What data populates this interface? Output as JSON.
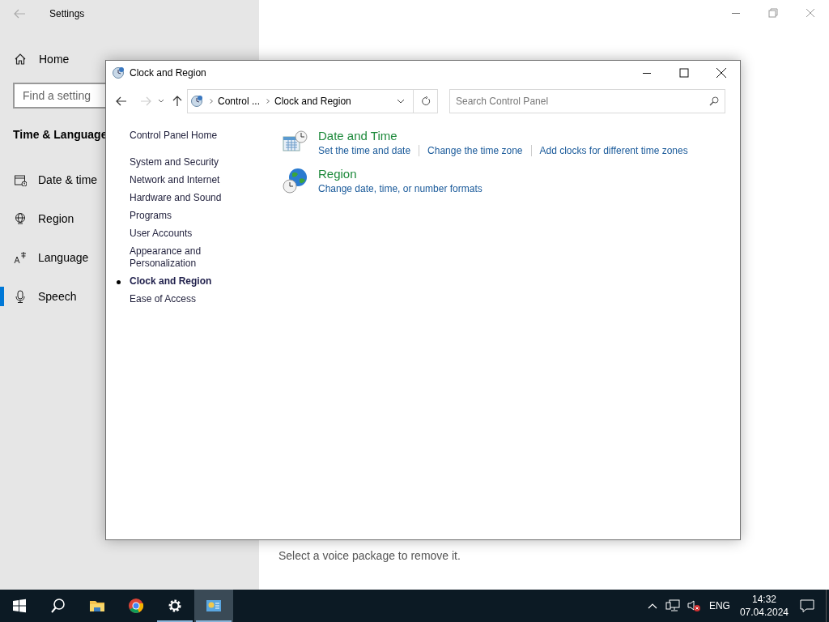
{
  "settings": {
    "title": "Settings",
    "home": "Home",
    "search_placeholder": "Find a setting",
    "section": "Time & Language",
    "nav": [
      {
        "kind": "calendar",
        "label": "Date & time",
        "selected": false
      },
      {
        "kind": "globe",
        "label": "Region",
        "selected": false
      },
      {
        "kind": "language",
        "label": "Language",
        "selected": false
      },
      {
        "kind": "microphone",
        "label": "Speech",
        "selected": true
      }
    ],
    "hint": "Select a voice package to remove it."
  },
  "control_panel": {
    "title": "Clock and Region",
    "breadcrumb": [
      "Control ...",
      "Clock and Region"
    ],
    "search_placeholder": "Search Control Panel",
    "home_link": "Control Panel Home",
    "nav": [
      {
        "label": "System and Security",
        "selected": false
      },
      {
        "label": "Network and Internet",
        "selected": false
      },
      {
        "label": "Hardware and Sound",
        "selected": false
      },
      {
        "label": "Programs",
        "selected": false
      },
      {
        "label": "User Accounts",
        "selected": false
      },
      {
        "label": "Appearance and Personalization",
        "selected": false
      },
      {
        "label": "Clock and Region",
        "selected": true
      },
      {
        "label": "Ease of Access",
        "selected": false
      }
    ],
    "categories": [
      {
        "kind": "datetime",
        "title": "Date and Time",
        "links": [
          "Set the time and date",
          "Change the time zone",
          "Add clocks for different time zones"
        ]
      },
      {
        "kind": "region",
        "title": "Region",
        "links": [
          "Change date, time, or number formats"
        ]
      }
    ]
  },
  "taskbar": {
    "apps": [
      {
        "kind": "start",
        "running": false,
        "active": false
      },
      {
        "kind": "search",
        "running": false,
        "active": false
      },
      {
        "kind": "explorer",
        "running": false,
        "active": false
      },
      {
        "kind": "browser",
        "running": false,
        "active": false
      },
      {
        "kind": "settings",
        "running": true,
        "active": false
      },
      {
        "kind": "control_panel",
        "running": true,
        "active": true
      }
    ],
    "language": "ENG",
    "time": "14:32",
    "date": "07.04.2024"
  }
}
